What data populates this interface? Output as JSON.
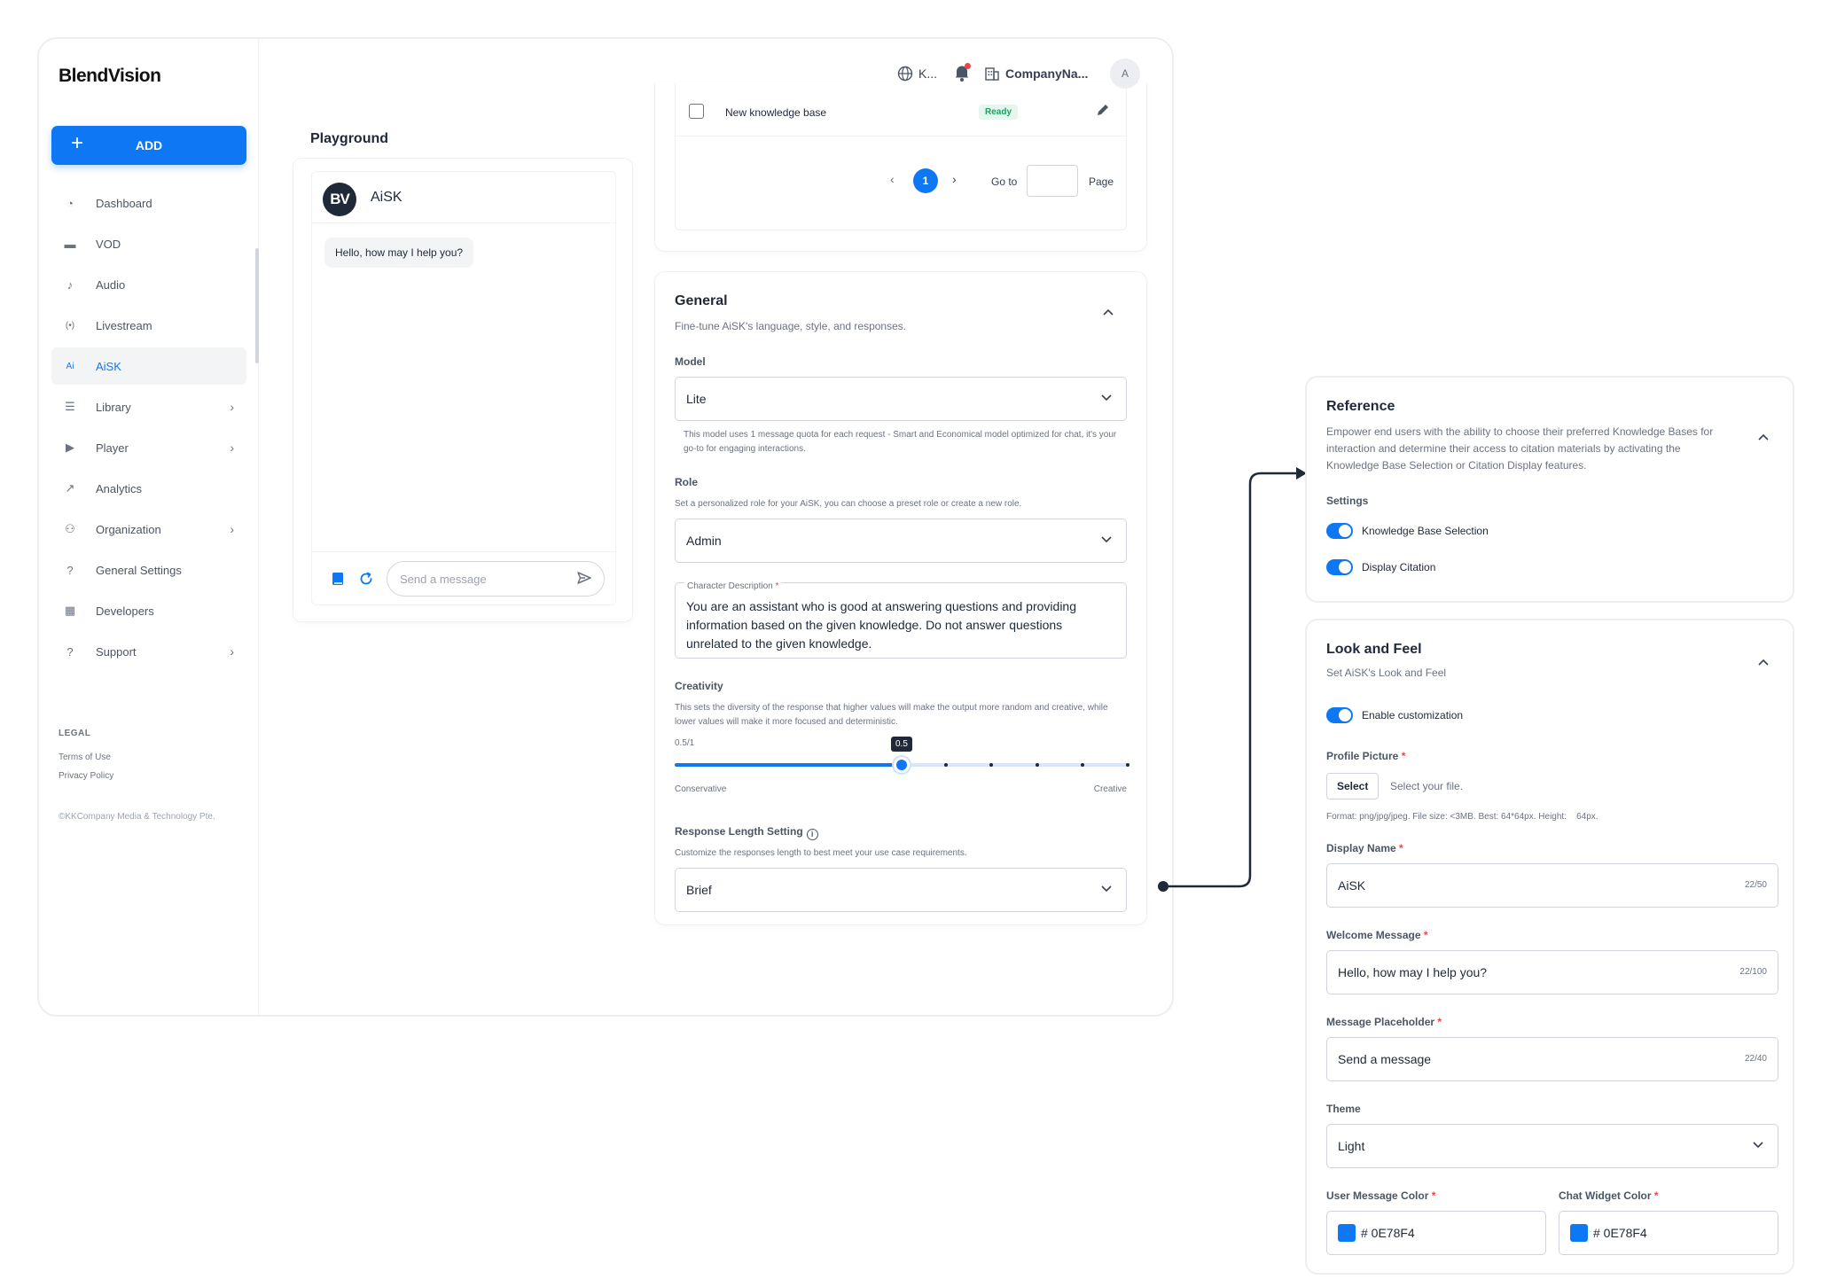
{
  "brand": {
    "logo_text": "BlendVision",
    "accent": "#0e78f4"
  },
  "sidebar": {
    "add_label": "ADD",
    "items": [
      {
        "label": "Dashboard",
        "icon": "dashboard-icon",
        "has_children": false,
        "active": false
      },
      {
        "label": "VOD",
        "icon": "vod-icon",
        "has_children": false,
        "active": false
      },
      {
        "label": "Audio",
        "icon": "audio-icon",
        "has_children": false,
        "active": false
      },
      {
        "label": "Livestream",
        "icon": "livestream-icon",
        "has_children": false,
        "active": false
      },
      {
        "label": "AiSK",
        "icon": "aisk-icon",
        "has_children": false,
        "active": true
      },
      {
        "label": "Library",
        "icon": "library-icon",
        "has_children": true,
        "active": false
      },
      {
        "label": "Player",
        "icon": "player-icon",
        "has_children": true,
        "active": false
      },
      {
        "label": "Analytics",
        "icon": "analytics-icon",
        "has_children": false,
        "active": false
      },
      {
        "label": "Organization",
        "icon": "organization-icon",
        "has_children": true,
        "active": false
      },
      {
        "label": "General Settings",
        "icon": "settings-icon",
        "has_children": false,
        "active": false
      },
      {
        "label": "Developers",
        "icon": "developers-icon",
        "has_children": false,
        "active": false
      },
      {
        "label": "Support",
        "icon": "support-icon",
        "has_children": true,
        "active": false
      }
    ],
    "legal_heading": "LEGAL",
    "terms": "Terms of Use",
    "privacy": "Privacy Policy",
    "copyright": "©KKCompany Media & Technology Pte."
  },
  "header": {
    "language": "K...",
    "company": "CompanyNa...",
    "avatar_initial": "A"
  },
  "playground": {
    "title": "Playground",
    "bot_logo": "BV",
    "bot_name": "AiSK",
    "welcome": "Hello, how may I help you?",
    "input_placeholder": "Send a message"
  },
  "knowledge_base": {
    "row_name": "New knowledge base",
    "status": "Ready",
    "current_page": "1",
    "goto_label": "Go to",
    "page_label": "Page"
  },
  "general": {
    "title": "General",
    "subtitle": "Fine-tune AiSK's language, style, and responses.",
    "model_label": "Model",
    "model_value": "Lite",
    "model_hint": "This model uses 1 message quota for each request - Smart and Economical model optimized for chat, it's your go-to for engaging interactions.",
    "role_label": "Role",
    "role_hint": "Set a personalized role for your AiSK, you can choose a preset role or create a new role.",
    "role_value": "Admin",
    "char_desc_label": "Character Description",
    "char_desc_value": "You are an assistant who is good at answering questions and providing information based on the given knowledge. Do not answer questions unrelated to the given knowledge.",
    "creativity_label": "Creativity",
    "creativity_hint": "This sets the diversity of the response that higher values will make the output more random and creative, while lower values will make it more focused and deterministic.",
    "creativity_readout": "0.5/1",
    "creativity_value": 0.5,
    "creativity_tooltip": "0.5",
    "creativity_min_label": "Conservative",
    "creativity_max_label": "Creative",
    "response_length_label": "Response Length Setting",
    "response_length_hint": "Customize the responses length to best meet your use case requirements.",
    "response_length_value": "Brief"
  },
  "reference": {
    "title": "Reference",
    "subtitle": "Empower end users with the ability to choose their preferred Knowledge Bases for interaction and determine their access to citation materials by activating the Knowledge Base Selection or Citation Display features.",
    "settings_label": "Settings",
    "kb_selection_label": "Knowledge Base Selection",
    "kb_selection_on": true,
    "display_citation_label": "Display Citation",
    "display_citation_on": true
  },
  "look_and_feel": {
    "title": "Look and Feel",
    "subtitle": "Set AiSK's Look and Feel",
    "enable_label": "Enable customization",
    "enable_on": true,
    "profile_picture_label": "Profile Picture",
    "select_button": "Select",
    "select_placeholder": "Select your file.",
    "format_hint": "Format: png/jpg/jpeg. File size: <3MB. Best: 64*64px. Height:    64px.",
    "display_name_label": "Display Name",
    "display_name_value": "AiSK",
    "display_name_count": "22/50",
    "welcome_label": "Welcome Message",
    "welcome_value": "Hello, how may I help you?",
    "welcome_count": "22/100",
    "placeholder_label": "Message Placeholder",
    "placeholder_value": "Send a message",
    "placeholder_count": "22/40",
    "theme_label": "Theme",
    "theme_value": "Light",
    "user_color_label": "User Message Color",
    "user_color_value": "# 0E78F4",
    "widget_color_label": "Chat Widget Color",
    "widget_color_value": "# 0E78F4"
  }
}
